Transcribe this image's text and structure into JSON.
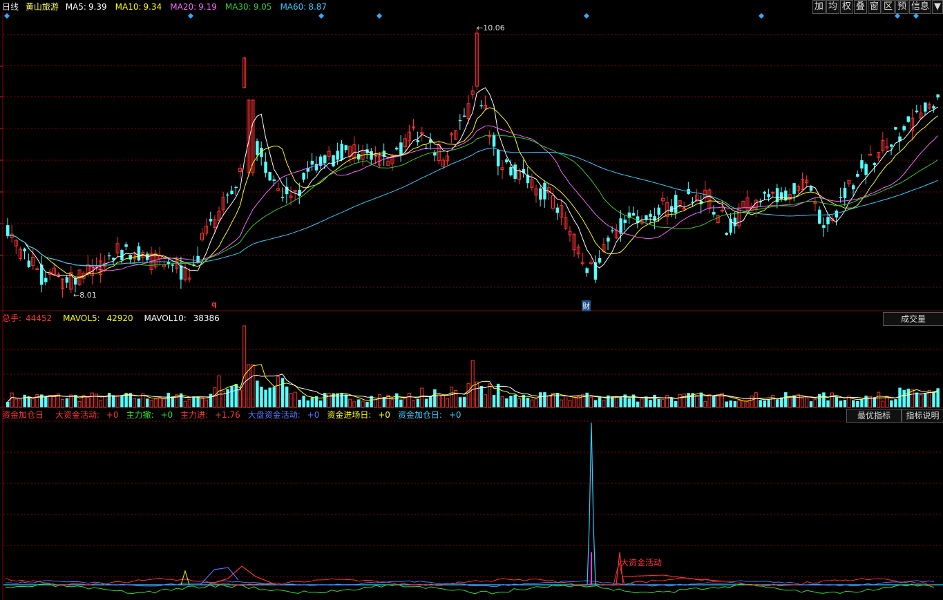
{
  "header": {
    "period": "日线",
    "stock_name": "黄山旅游",
    "ma": [
      {
        "label": "MA5:",
        "value": "9.39",
        "color": "#ffffff"
      },
      {
        "label": "MA10:",
        "value": "9.34",
        "color": "#ffff00"
      },
      {
        "label": "MA20:",
        "value": "9.19",
        "color": "#ff66ff"
      },
      {
        "label": "MA30:",
        "value": "9.05",
        "color": "#33cc33"
      },
      {
        "label": "MA60:",
        "value": "8.87",
        "color": "#33ccff"
      }
    ]
  },
  "toolbar": [
    "加",
    "均",
    "权",
    "叠",
    "窗",
    "区",
    "预",
    "信息",
    "▼"
  ],
  "price_panel": {
    "high_label": "10.06",
    "low_label": "8.01",
    "marker_q": "q",
    "marker_cai": "财"
  },
  "volume_panel": {
    "title": "总手:",
    "total": "44452",
    "mavol5_label": "MAVOL5:",
    "mavol5": "42920",
    "mavol10_label": "MAVOL10:",
    "mavol10": "38386",
    "button": "成交量"
  },
  "indicator_panel": {
    "items": [
      {
        "label": "资金加仓日",
        "value": "",
        "color": "#ff3333"
      },
      {
        "label": "大资金活动:",
        "value": "+0",
        "color": "#ff3333"
      },
      {
        "label": "主力撤:",
        "value": "+0",
        "color": "#33dd33"
      },
      {
        "label": "主力进:",
        "value": "+1.76",
        "color": "#ff3333"
      },
      {
        "label": "大盘资金活动:",
        "value": "+0",
        "color": "#5577ff"
      },
      {
        "label": "资金进场日:",
        "value": "+0",
        "color": "#ffff00"
      },
      {
        "label": "资金加仓日:",
        "value": "+0",
        "color": "#33ccff"
      }
    ],
    "button_best": "最优指标",
    "button_desc": "指标说明",
    "annotation": "大资金活动"
  },
  "colors": {
    "up": "#ff3232",
    "down": "#54ffff",
    "grid": "#8b0000",
    "ma5": "#ffffff",
    "ma10": "#ffff00",
    "ma20": "#ff66ff",
    "ma30": "#33cc33",
    "ma60": "#33ccff"
  }
}
